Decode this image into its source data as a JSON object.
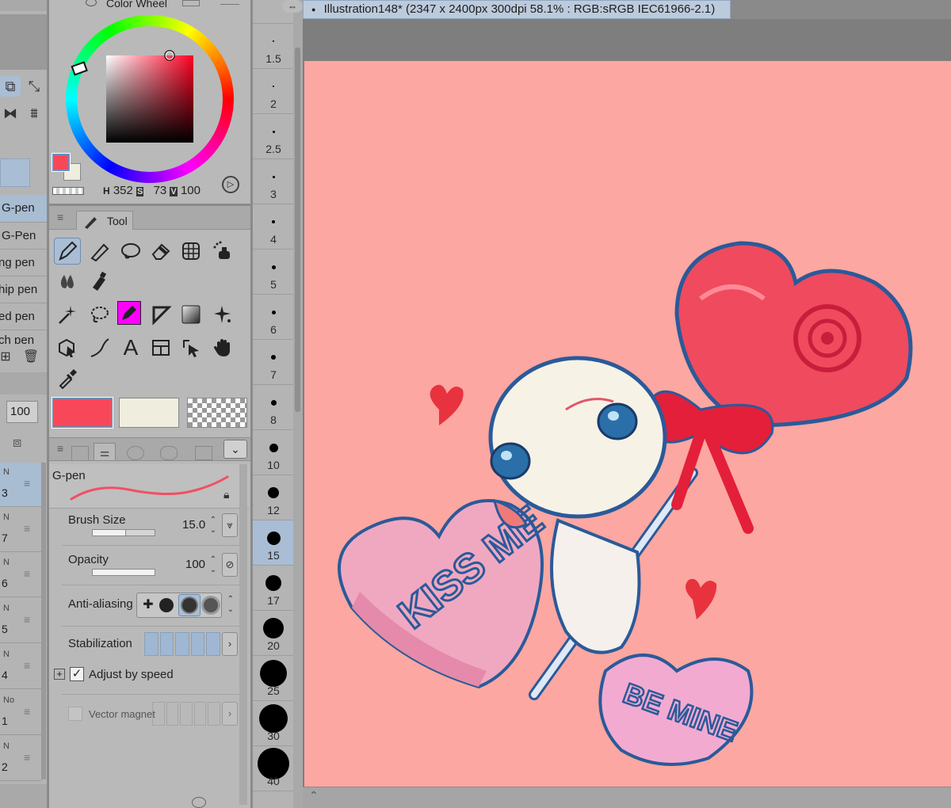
{
  "left_panel": {
    "brush_items": [
      "G-pen",
      "G-Pen",
      "ng pen",
      "hip pen",
      "ed pen",
      "ch pen"
    ],
    "opacity_value": "100",
    "layers": [
      {
        "mode": "N",
        "number": "3"
      },
      {
        "mode": "N",
        "number": "7"
      },
      {
        "mode": "N",
        "number": "6"
      },
      {
        "mode": "N",
        "number": "5"
      },
      {
        "mode": "N",
        "number": "4"
      },
      {
        "mode": "No",
        "number": "1"
      },
      {
        "mode": "N",
        "number": "2"
      }
    ]
  },
  "color_wheel": {
    "title": "Color Wheel",
    "h_label": "H",
    "h_value": "352",
    "s_label": "S",
    "s_value": "73",
    "v_label": "V",
    "v_value": "100",
    "main_color": "#f9475a",
    "sub_color": "#efedde"
  },
  "tool_panel": {
    "tab_label": "Tool",
    "icons": [
      "pen-icon",
      "eraser-pencil-icon",
      "lasso-blob-icon",
      "eraser-icon",
      "mesh-icon",
      "airbrush-icon",
      "water-drop-icon",
      "fill-bottle-icon",
      "magic-wand-icon",
      "lasso-icon",
      "selection-pen-icon",
      "ruler-triangle-icon",
      "gradient-icon",
      "sparkle-icon",
      "object-select-icon",
      "curve-icon",
      "text-icon",
      "frame-icon",
      "move-layer-icon",
      "hand-icon",
      "eyedropper-icon"
    ],
    "swatches": {
      "main": "#f9475a",
      "sub": "#efedde"
    }
  },
  "brush_properties": {
    "brush_name": "G-pen",
    "brush_size_label": "Brush Size",
    "brush_size_value": "15.0",
    "opacity_label": "Opacity",
    "opacity_value": "100",
    "antialiasing_label": "Anti-aliasing",
    "stabilization_label": "Stabilization",
    "adjust_speed_label": "Adjust by speed",
    "adjust_speed_checked": true,
    "vector_magnet_label": "Vector magnet"
  },
  "brush_sizes": [
    "1.5",
    "2",
    "2.5",
    "3",
    "4",
    "5",
    "6",
    "7",
    "8",
    "10",
    "12",
    "15",
    "17",
    "20",
    "25",
    "30",
    "40"
  ],
  "brush_size_selected": "15",
  "canvas": {
    "tab_title": "Illustration148* (2347 x 2400px 300dpi 58.1% : RGB:sRGB IEC61966-2.1)",
    "background": "#fca7a1",
    "sticker_text_1": "KISS ME",
    "sticker_text_2": "BE MINE"
  }
}
